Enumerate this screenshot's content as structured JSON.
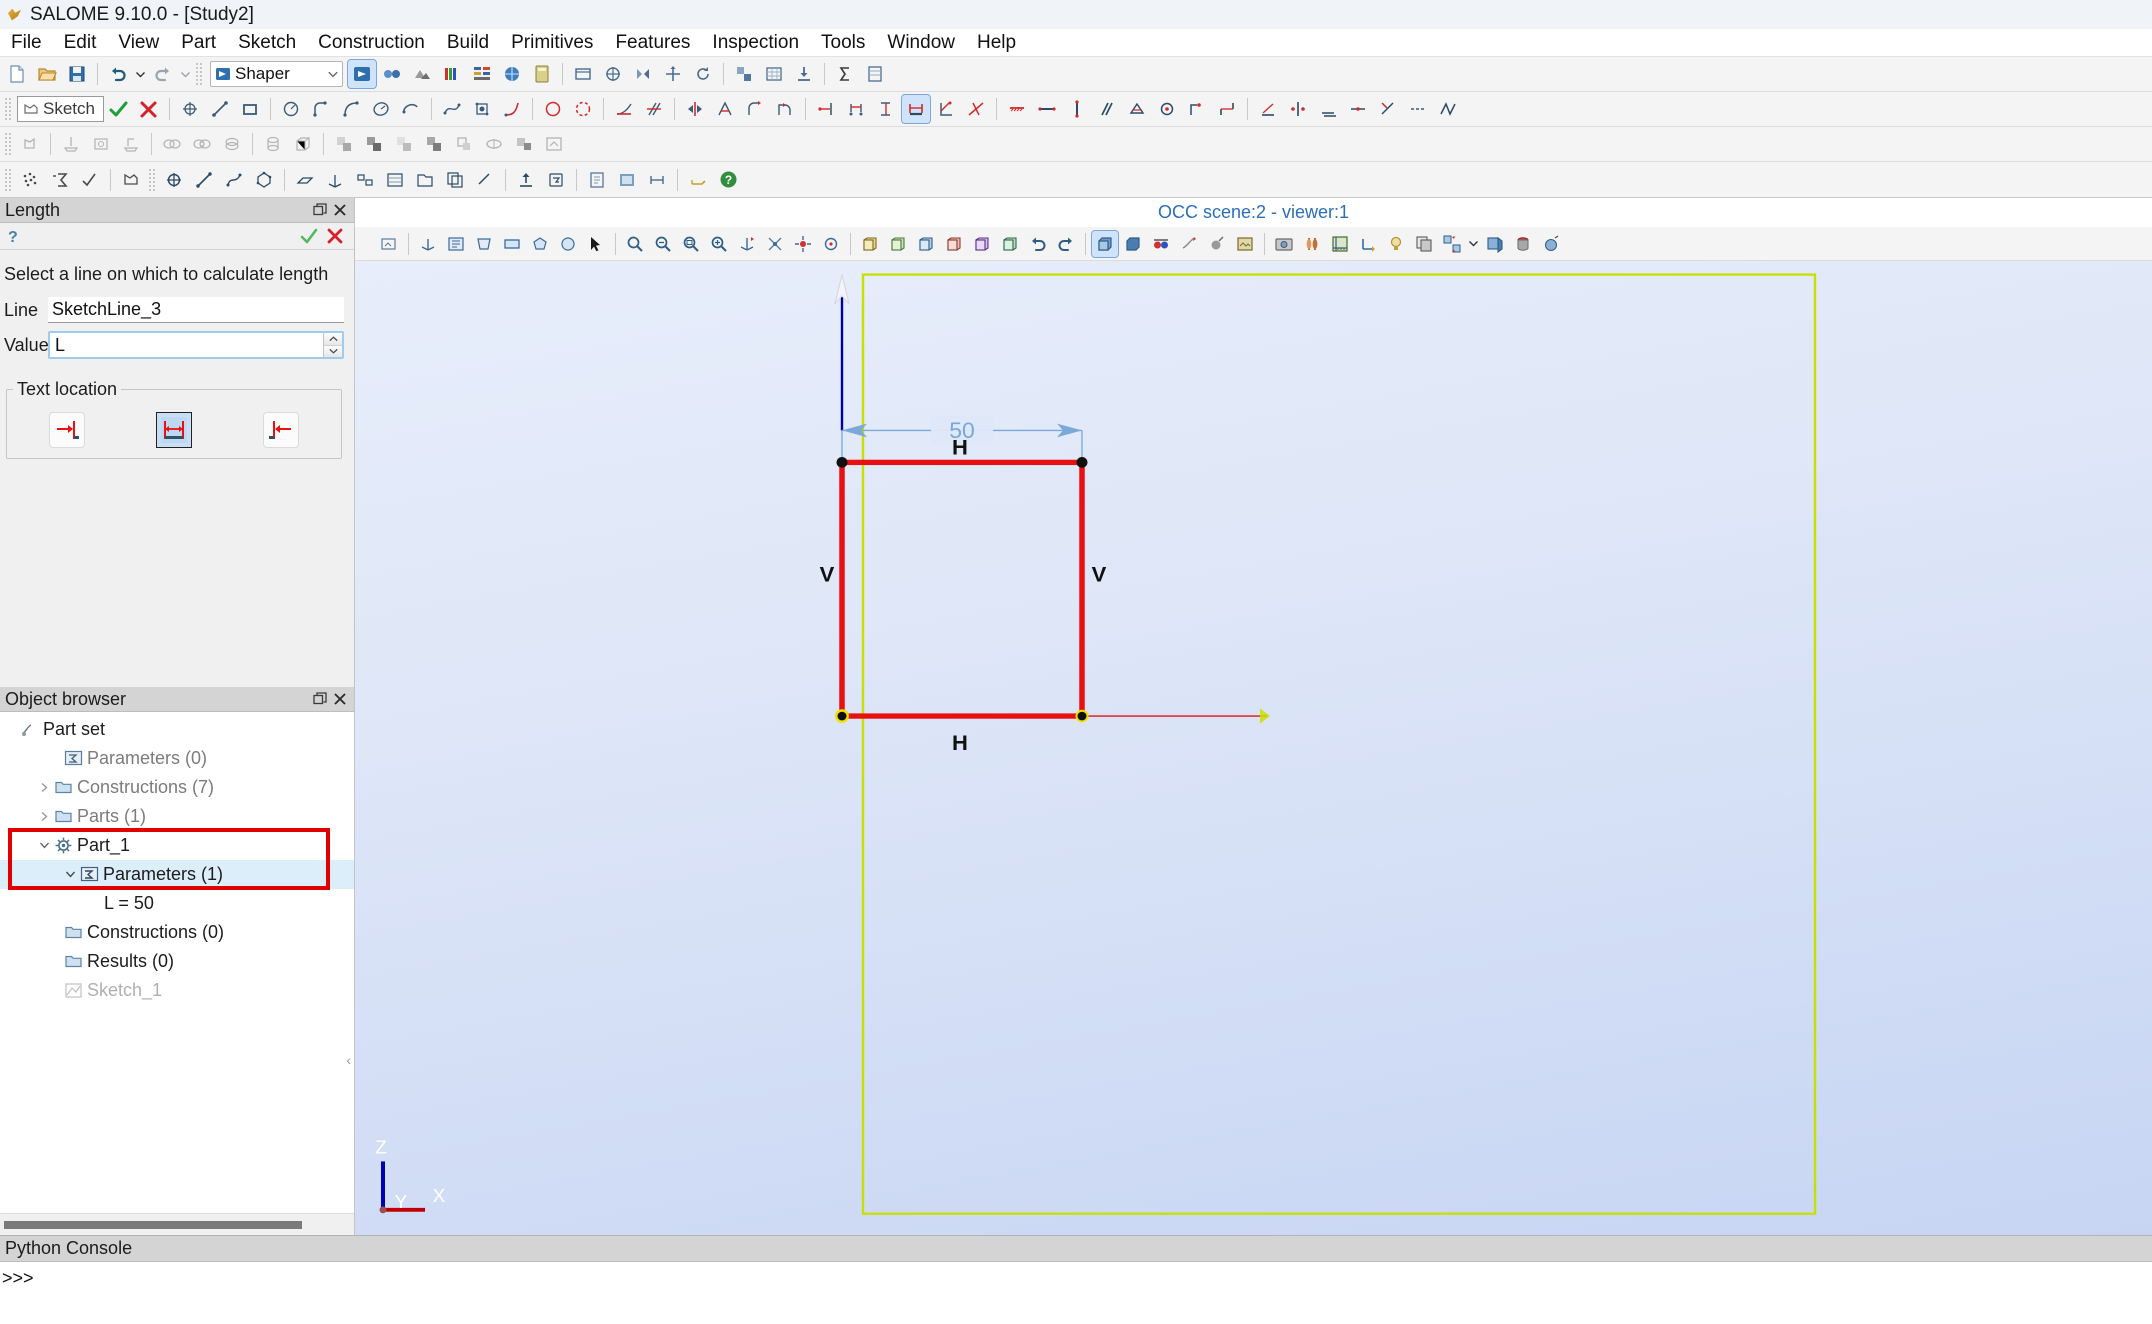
{
  "window": {
    "title": "SALOME 9.10.0 - [Study2]",
    "icon": "salome-logo-icon"
  },
  "menubar": {
    "items": [
      {
        "label": "File"
      },
      {
        "label": "Edit"
      },
      {
        "label": "View"
      },
      {
        "label": "Part"
      },
      {
        "label": "Sketch"
      },
      {
        "label": "Construction"
      },
      {
        "label": "Build"
      },
      {
        "label": "Primitives"
      },
      {
        "label": "Features"
      },
      {
        "label": "Inspection"
      },
      {
        "label": "Tools"
      },
      {
        "label": "Window"
      },
      {
        "label": "Help"
      }
    ]
  },
  "toolbar_main": {
    "module_selector": {
      "value": "Shaper",
      "icon": "shaper-module-icon"
    },
    "new_label": "New",
    "open_label": "Open",
    "save_label": "Save",
    "undo_label": "Undo",
    "redo_label": "Redo"
  },
  "toolbar_sketch": {
    "sketch_button_label": "Sketch",
    "accept_label": "Apply",
    "reject_label": "Cancel"
  },
  "length_panel": {
    "title": "Length",
    "hint": "Select a line on which to calculate length",
    "line_label": "Line",
    "line_value": "SketchLine_3",
    "value_label": "Value",
    "value_value": "L",
    "text_location_label": "Text location",
    "text_location_options": [
      {
        "name": "left",
        "selected": false
      },
      {
        "name": "automatic",
        "selected": true
      },
      {
        "name": "right",
        "selected": false
      }
    ],
    "accept_label": "Apply",
    "reject_label": "Cancel",
    "undock_label": "Undock",
    "close_label": "Close"
  },
  "object_browser": {
    "title": "Object browser",
    "undock_label": "Undock",
    "close_label": "Close",
    "nodes": [
      {
        "label": "Part set",
        "icon": "partset-icon",
        "indent": 0,
        "arrow": "none",
        "style": "normal"
      },
      {
        "label": "Parameters (0)",
        "icon": "parameters-icon",
        "indent": 2,
        "arrow": "none",
        "style": "dim"
      },
      {
        "label": "Constructions (7)",
        "icon": "folder-icon",
        "indent": 1,
        "arrow": "collapsed",
        "style": "dim"
      },
      {
        "label": "Parts (1)",
        "icon": "folder-icon",
        "indent": 1,
        "arrow": "collapsed",
        "style": "dim"
      },
      {
        "label": "Part_1",
        "icon": "part-gear-icon",
        "indent": 1,
        "arrow": "expanded",
        "style": "normal"
      },
      {
        "label": "Parameters (1)",
        "icon": "parameters-icon",
        "indent": 2,
        "arrow": "expanded",
        "style": "normal",
        "highlight": true
      },
      {
        "label": "L = 50",
        "icon": "none",
        "indent": 4,
        "arrow": "none",
        "style": "normal"
      },
      {
        "label": "Constructions (0)",
        "icon": "folder-icon",
        "indent": 2,
        "arrow": "none",
        "style": "normal"
      },
      {
        "label": "Results (0)",
        "icon": "folder-icon",
        "indent": 2,
        "arrow": "none",
        "style": "normal"
      },
      {
        "label": "Sketch_1",
        "icon": "sketch-icon",
        "indent": 2,
        "arrow": "none",
        "style": "gray"
      }
    ],
    "annotation_color": "#e00000"
  },
  "viewer": {
    "title": "OCC scene:2 - viewer:1",
    "sketch": {
      "dimension_label": "50",
      "constraints": [
        {
          "label": "H",
          "position": "top"
        },
        {
          "label": "V",
          "position": "left"
        },
        {
          "label": "V",
          "position": "right"
        },
        {
          "label": "H",
          "position": "bottom"
        }
      ],
      "geometry_color": "#e81010",
      "dimension_color": "#7aa8d8",
      "axis_color": "#00009c",
      "selection_color": "#c8e000"
    },
    "trihedron": {
      "x_label": "X",
      "y_label": "Y",
      "z_label": "Z"
    }
  },
  "python_console": {
    "title": "Python Console",
    "prompt": ">>>"
  }
}
